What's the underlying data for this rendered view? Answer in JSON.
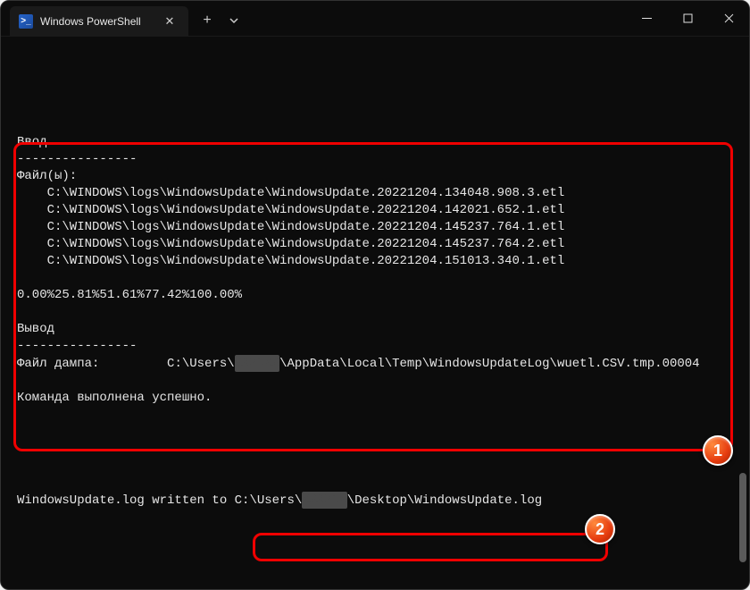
{
  "tab": {
    "title": "Windows PowerShell",
    "icon_glyph": ">_"
  },
  "output": {
    "input_header": "Ввод",
    "input_divider": "----------------",
    "files_label": "Файл(ы):",
    "etl_files": [
      "C:\\WINDOWS\\logs\\WindowsUpdate\\WindowsUpdate.20221204.134048.908.3.etl",
      "C:\\WINDOWS\\logs\\WindowsUpdate\\WindowsUpdate.20221204.142021.652.1.etl",
      "C:\\WINDOWS\\logs\\WindowsUpdate\\WindowsUpdate.20221204.145237.764.1.etl",
      "C:\\WINDOWS\\logs\\WindowsUpdate\\WindowsUpdate.20221204.145237.764.2.etl",
      "C:\\WINDOWS\\logs\\WindowsUpdate\\WindowsUpdate.20221204.151013.340.1.etl"
    ],
    "progress": "0.00%25.81%51.61%77.42%100.00%",
    "output_header": "Вывод",
    "output_divider": "----------------",
    "dump_label": "Файл дампа:",
    "dump_prefix": "C:\\Users\\",
    "dump_suffix": "\\AppData\\Local\\Temp\\WindowsUpdateLog\\wuetl.CSV.tmp.00004",
    "success_msg": "Команда выполнена успешно.",
    "written_prefix": "WindowsUpdate.log written to ",
    "written_path_pre": "C:\\Users\\",
    "written_path_post": "\\Desktop\\WindowsUpdate.log"
  },
  "annotations": {
    "badge1": "1",
    "badge2": "2"
  }
}
